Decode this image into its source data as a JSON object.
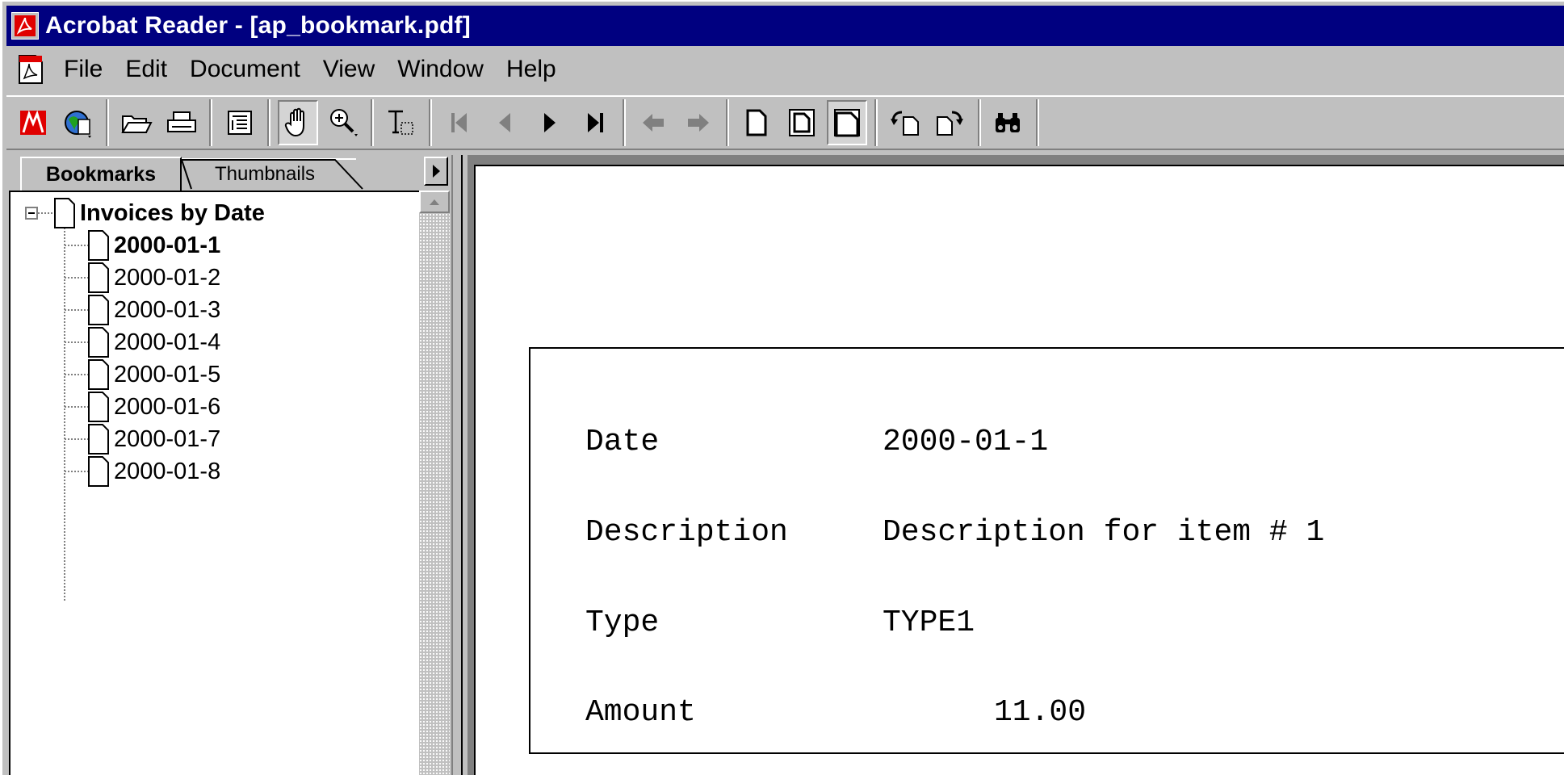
{
  "window": {
    "title": "Acrobat Reader - [ap_bookmark.pdf]"
  },
  "menu": {
    "items": [
      "File",
      "Edit",
      "Document",
      "View",
      "Window",
      "Help"
    ]
  },
  "toolbar": {
    "buttons": [
      "acrobat-logo-icon",
      "web-link-icon",
      "open-folder-icon",
      "print-icon",
      "show-hide-navigation-icon",
      "hand-tool-icon",
      "zoom-tool-icon",
      "text-select-tool-icon",
      "first-page-icon",
      "previous-page-icon",
      "next-page-icon",
      "last-page-icon",
      "go-back-icon",
      "go-forward-icon",
      "actual-size-icon",
      "fit-in-window-icon",
      "fit-width-icon",
      "rotate-counterclockwise-icon",
      "rotate-clockwise-icon",
      "find-icon"
    ],
    "pressed": [
      "hand-tool-icon",
      "fit-width-icon"
    ]
  },
  "navigation": {
    "tabs": [
      "Bookmarks",
      "Thumbnails"
    ],
    "active_tab": "Bookmarks",
    "root": "Invoices by Date",
    "bookmarks": [
      "2000-01-1",
      "2000-01-2",
      "2000-01-3",
      "2000-01-4",
      "2000-01-5",
      "2000-01-6",
      "2000-01-7",
      "2000-01-8"
    ],
    "selected": "2000-01-1"
  },
  "document": {
    "date_label": "Date",
    "date_value": "2000-01-1",
    "description_label": "Description",
    "description_value": "Description for item # 1",
    "type_label": "Type",
    "type_value": "TYPE1",
    "amount_label": "Amount",
    "amount_value": "11.00"
  },
  "colors": {
    "titlebar": "#000080",
    "chrome": "#c0c0c0",
    "acrobat_red": "#e00000"
  }
}
